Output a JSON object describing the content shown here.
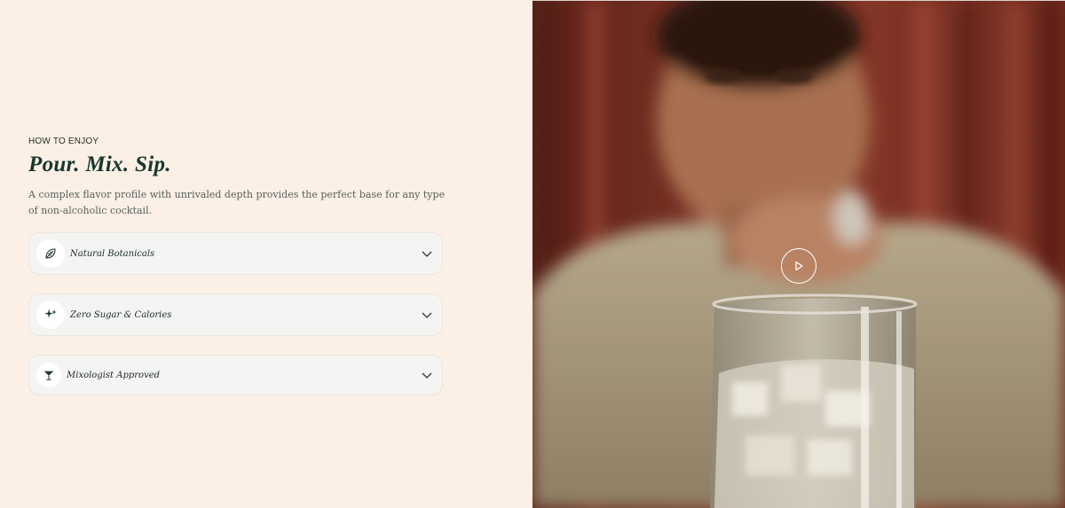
{
  "section": {
    "eyebrow": "HOW TO ENJOY",
    "headline": "Pour. Mix. Sip.",
    "description": "A complex flavor profile with unrivaled depth provides the perfect base for any type of non-alcoholic cocktail."
  },
  "accordion": [
    {
      "label": "Natural Botanicals",
      "icon": "leaf-icon"
    },
    {
      "label": "Zero Sugar & Calories",
      "icon": "sparkle-icon"
    },
    {
      "label": "Mixologist Approved",
      "icon": "cocktail-glass-icon"
    }
  ],
  "video": {
    "play_icon": "play-icon"
  },
  "colors": {
    "background": "#fcf0e6",
    "heading": "#17372d",
    "accordion_bg": "#f4f4f2"
  }
}
